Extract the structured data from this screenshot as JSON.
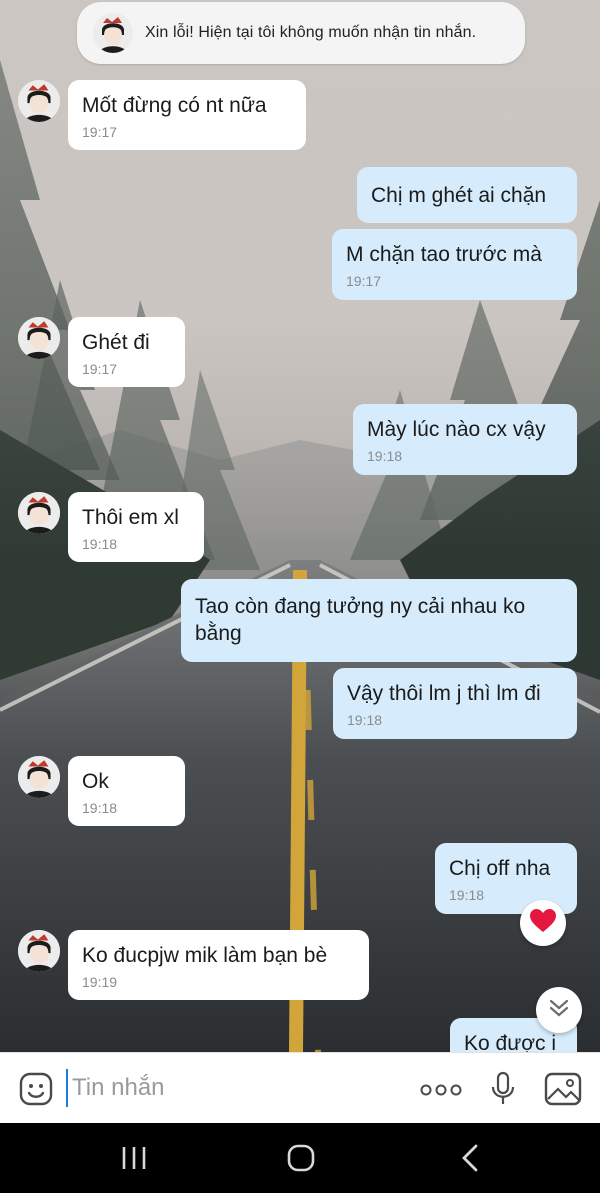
{
  "system_notice": {
    "text": "Xin lỗi! Hiện tại tôi không muốn nhận tin nhắn."
  },
  "messages": [
    {
      "side": "in",
      "text": "Mốt đừng có nt  nữa",
      "time": "19:17"
    },
    {
      "side": "out",
      "text": "Chị m ghét ai chặn",
      "time": ""
    },
    {
      "side": "out",
      "text": "M chặn tao trước mà",
      "time": "19:17"
    },
    {
      "side": "in",
      "text": "Ghét đi",
      "time": "19:17"
    },
    {
      "side": "out",
      "text": "Mày lúc nào cx vậy",
      "time": "19:18"
    },
    {
      "side": "in",
      "text": "Thôi em xl",
      "time": "19:18"
    },
    {
      "side": "out",
      "text": "Tao còn đang tưởng ny cải nhau ko bằng",
      "time": ""
    },
    {
      "side": "out",
      "text": "Vậy thôi lm j thì lm đi",
      "time": "19:18"
    },
    {
      "side": "in",
      "text": "Ok",
      "time": "19:18"
    },
    {
      "side": "out",
      "text": "Chị off nha",
      "time": "19:18"
    },
    {
      "side": "in",
      "text": "Ko đucpjw mik làm bạn bè",
      "time": "19:19"
    },
    {
      "side": "out",
      "text": "Ko được i",
      "time": ""
    }
  ],
  "input_bar": {
    "placeholder": "Tin nhắn",
    "icons": [
      "sticker-icon",
      "more-icon",
      "microphone-icon",
      "image-icon"
    ]
  },
  "floating": {
    "reaction_icon": "heart-icon",
    "scroll_icon": "double-chevron-down-icon"
  },
  "nav_bar": {
    "icons": [
      "recent-apps-icon",
      "home-icon",
      "back-icon"
    ]
  },
  "colors": {
    "incoming_bubble": "#ffffff",
    "outgoing_bubble": "#d6ecfc",
    "heart": "#e4173f",
    "cursor": "#1e7ae0"
  }
}
